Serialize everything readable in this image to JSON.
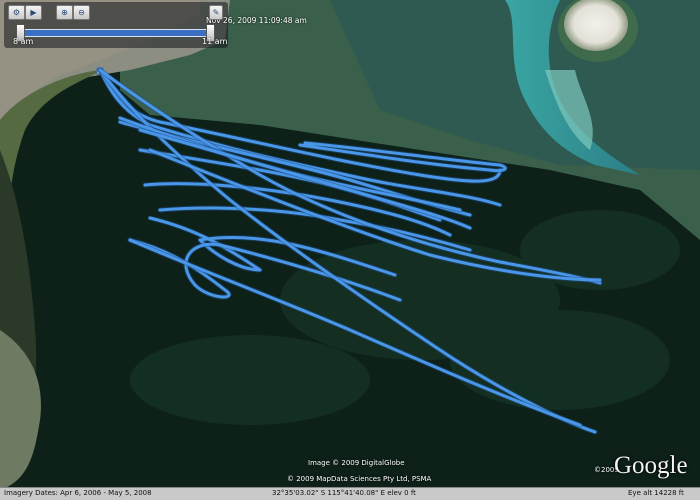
{
  "time_slider": {
    "date_time": "Nov 26, 2009  11:09:48 am",
    "start_time": "8 am",
    "end_time": "11 am",
    "progress": 1.0,
    "buttons": [
      "settings",
      "play",
      "zoom-in",
      "zoom-out"
    ]
  },
  "map": {
    "imagery_credit": "Image © 2009 DigitalGlobe",
    "data_credit": "© 2009 MapData Sciences Pty Ltd, PSMA",
    "logo_text": "Google",
    "logo_year": "©2009",
    "track_color": "#4a96e8"
  },
  "status_bar": {
    "imagery_dates": "Imagery Dates: Apr 6, 2006 - May 5, 2008",
    "coordinates": "32°35'03.02\" S    115°41'40.08\" E    elev    0 ft",
    "eye_alt": "Eye alt    14228 ft"
  }
}
